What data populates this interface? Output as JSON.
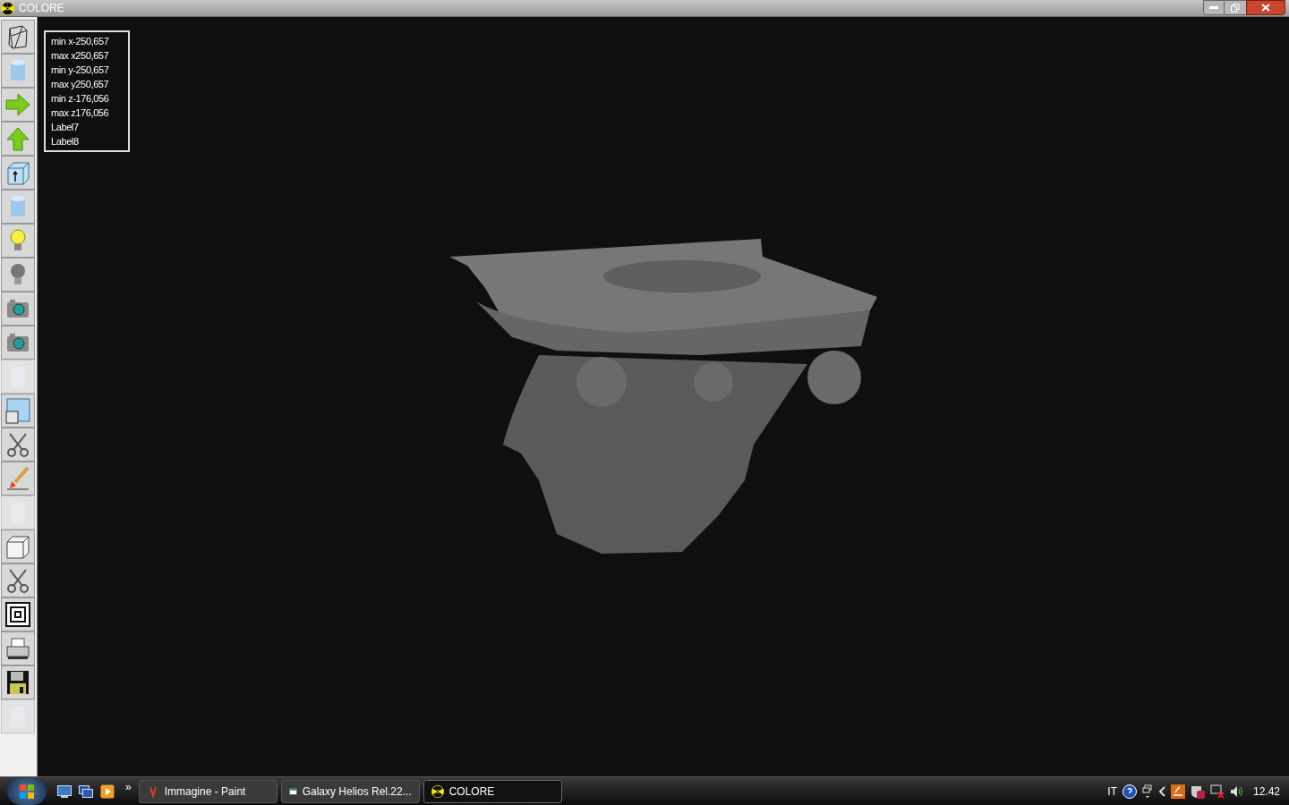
{
  "window": {
    "title": "COLORE"
  },
  "toolbar": [
    {
      "kind": "wireframe",
      "disabled": false
    },
    {
      "kind": "cylinder",
      "disabled": false
    },
    {
      "kind": "arrow-right",
      "disabled": false
    },
    {
      "kind": "arrow-up",
      "disabled": false
    },
    {
      "kind": "box-arrow",
      "disabled": false
    },
    {
      "kind": "cylinder",
      "disabled": false
    },
    {
      "kind": "bulb-on",
      "disabled": false
    },
    {
      "kind": "bulb-off",
      "disabled": false
    },
    {
      "kind": "camera",
      "disabled": false
    },
    {
      "kind": "camera",
      "disabled": false
    },
    {
      "kind": "blank",
      "disabled": true
    },
    {
      "kind": "window",
      "disabled": false
    },
    {
      "kind": "scissors",
      "disabled": false
    },
    {
      "kind": "brush",
      "disabled": false
    },
    {
      "kind": "blank",
      "disabled": true
    },
    {
      "kind": "cube",
      "disabled": false
    },
    {
      "kind": "scissors",
      "disabled": false
    },
    {
      "kind": "squares",
      "disabled": false
    },
    {
      "kind": "printer",
      "disabled": false
    },
    {
      "kind": "floppy",
      "disabled": false
    },
    {
      "kind": "blank",
      "disabled": true
    }
  ],
  "info_panel": [
    "min x-250,657",
    "max x250,657",
    "min y-250,657",
    "max y250,657",
    "min z-176,056",
    "max z176,056",
    "Label7",
    "Label8"
  ],
  "taskbar": {
    "overflow": "»",
    "tasks": [
      {
        "label": "Immagine - Paint",
        "kind": "paint",
        "selected": false
      },
      {
        "label": "Galaxy Helios  Rel.22...",
        "kind": "app",
        "selected": false
      },
      {
        "label": "COLORE",
        "kind": "hazard",
        "selected": true
      }
    ],
    "language": "IT",
    "clock": "12.42"
  }
}
